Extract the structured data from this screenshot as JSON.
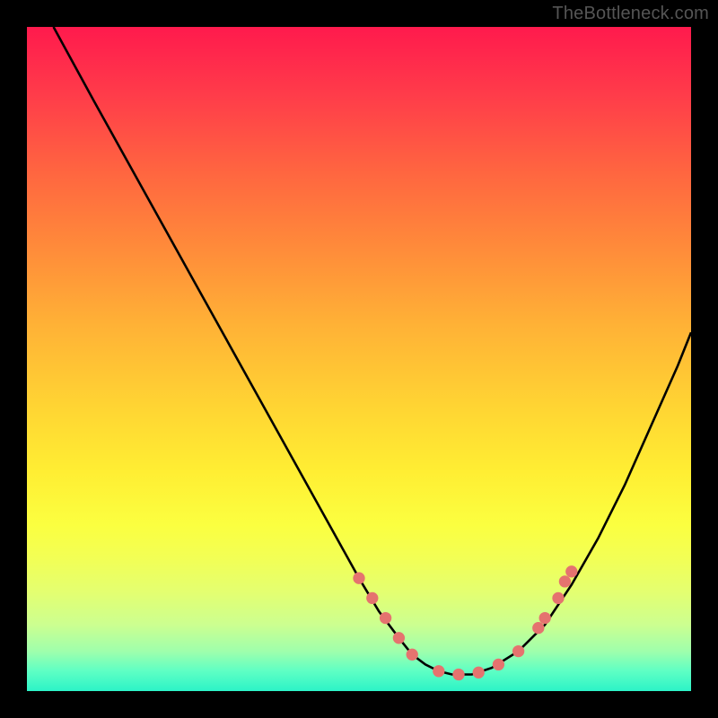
{
  "watermark": "TheBottleneck.com",
  "chart_data": {
    "type": "line",
    "title": "",
    "xlabel": "",
    "ylabel": "",
    "xlim": [
      0,
      100
    ],
    "ylim": [
      0,
      100
    ],
    "series": [
      {
        "name": "bottleneck-curve",
        "x": [
          4,
          10,
          15,
          20,
          25,
          30,
          35,
          40,
          45,
          50,
          53,
          56,
          58,
          60,
          62,
          64,
          67,
          70,
          74,
          78,
          82,
          86,
          90,
          94,
          98,
          100
        ],
        "y": [
          100,
          89,
          80,
          71,
          62,
          53,
          44,
          35,
          26,
          17,
          12,
          8,
          5.5,
          4,
          3,
          2.5,
          2.5,
          3.5,
          6,
          10,
          16,
          23,
          31,
          40,
          49,
          54
        ]
      }
    ],
    "markers": {
      "name": "data-points",
      "color": "#e5736f",
      "x": [
        50,
        52,
        54,
        56,
        58,
        62,
        65,
        68,
        71,
        74,
        77,
        78,
        80,
        81,
        82
      ],
      "y": [
        17,
        14,
        11,
        8,
        5.5,
        3,
        2.5,
        2.8,
        4,
        6,
        9.5,
        11,
        14,
        16.5,
        18
      ]
    },
    "background_gradient": [
      "#ff1a4d",
      "#ffd433",
      "#2cf3c7"
    ]
  }
}
